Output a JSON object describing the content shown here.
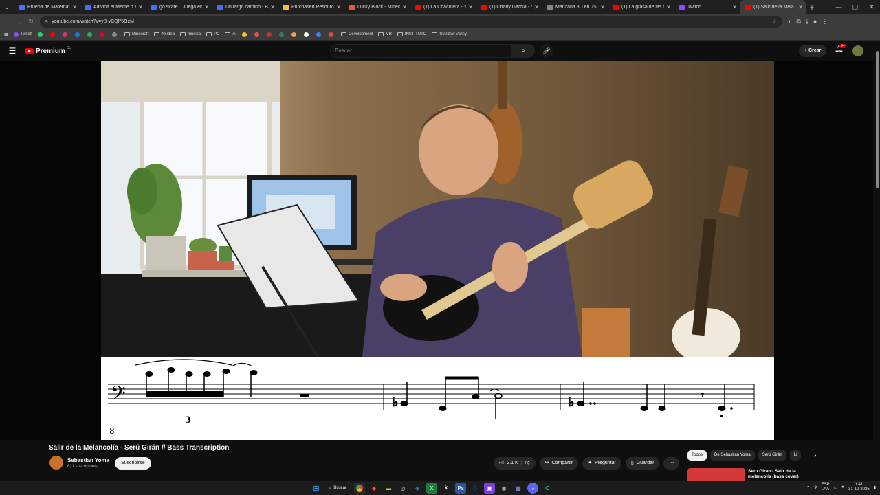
{
  "browser": {
    "tabs": [
      {
        "title": "Prueba de Matemática",
        "color": "#4a6cf7",
        "active": false
      },
      {
        "title": "Adivina el Meme o M",
        "color": "#4a6cf7",
        "active": false
      },
      {
        "title": "go skate. | Juega en R",
        "color": "#4a6cf7",
        "active": false
      },
      {
        "title": "Un largo camino - BET",
        "color": "#4a6cf7",
        "active": false
      },
      {
        "title": "Purchased Resources |",
        "color": "#f2c12e",
        "active": false
      },
      {
        "title": "Lucky Block - Minecraft",
        "color": "#e5534b",
        "active": false
      },
      {
        "title": "(1) La Chacotera - YouT",
        "color": "#ff0000",
        "active": false
      },
      {
        "title": "(1) Charly García - No",
        "color": "#ff0000",
        "active": false
      },
      {
        "title": "Manzana 3D en JSON",
        "color": "#888888",
        "active": false
      },
      {
        "title": "(1) La grasa de las cap",
        "color": "#ff0000",
        "active": false
      },
      {
        "title": "Twitch",
        "color": "#9146ff",
        "active": false
      },
      {
        "title": "(1) Salir de la Mela",
        "color": "#ff0000",
        "active": true
      }
    ],
    "url": "youtube.com/watch?v=yB-yCQP5OzM",
    "bookmarks": [
      {
        "label": "Twitch",
        "type": "icon",
        "color": "#9146ff"
      },
      {
        "label": "",
        "type": "icon",
        "color": "#25d366"
      },
      {
        "label": "",
        "type": "icon",
        "color": "#ff0000"
      },
      {
        "label": "",
        "type": "icon",
        "color": "#e1306c"
      },
      {
        "label": "",
        "type": "icon",
        "color": "#1877f2"
      },
      {
        "label": "",
        "type": "icon",
        "color": "#1db954"
      },
      {
        "label": "",
        "type": "icon",
        "color": "#e60023"
      },
      {
        "label": "",
        "type": "icon",
        "color": "#888888"
      },
      {
        "label": "Minecraft",
        "type": "folder"
      },
      {
        "label": "Ni idea",
        "type": "folder"
      },
      {
        "label": "musica",
        "type": "folder"
      },
      {
        "label": "PC",
        "type": "folder"
      },
      {
        "label": "AI",
        "type": "folder"
      },
      {
        "label": "",
        "type": "icon",
        "color": "#f2c12e"
      },
      {
        "label": "",
        "type": "icon",
        "color": "#e5534b"
      },
      {
        "label": "",
        "type": "icon",
        "color": "#cc3333"
      },
      {
        "label": "",
        "type": "icon",
        "color": "#2e7d5b"
      },
      {
        "label": "",
        "type": "icon",
        "color": "#f2a33a"
      },
      {
        "label": "",
        "type": "icon",
        "color": "#ffffff"
      },
      {
        "label": "",
        "type": "icon",
        "color": "#3b82f6"
      },
      {
        "label": "",
        "type": "icon",
        "color": "#ef4444"
      },
      {
        "label": "Development",
        "type": "folder"
      },
      {
        "label": "VR",
        "type": "folder"
      },
      {
        "label": "INSTITUTO",
        "type": "folder"
      },
      {
        "label": "Stardew Valley",
        "type": "folder"
      }
    ]
  },
  "youtube": {
    "logo_text": "Premium",
    "region": "CL",
    "search_placeholder": "Buscar",
    "create_label": "Crear",
    "notification_count": "9+",
    "video": {
      "title": "Salir de la Melancolía - Serú Girán // Bass Transcription",
      "channel": "Sebastian Yoma",
      "subscribers": "621 suscriptores",
      "subscribe_label": "Suscribirse",
      "likes": "2.1 K",
      "share_label": "Compartir",
      "ask_label": "Preguntar",
      "save_label": "Guardar"
    },
    "sheet": {
      "triplet_number": "3",
      "measure_number": "8"
    },
    "chips": [
      "Todos",
      "De Sebastian Yoma",
      "Serú Girán",
      "Li"
    ],
    "recommendation": {
      "title": "Seru Giran - Salir de la melancolía (bass cover)"
    }
  },
  "taskbar": {
    "search_label": "Buscar",
    "language": "ESP",
    "layout": "LAA",
    "time": "1:41",
    "date": "31-12-2025"
  }
}
